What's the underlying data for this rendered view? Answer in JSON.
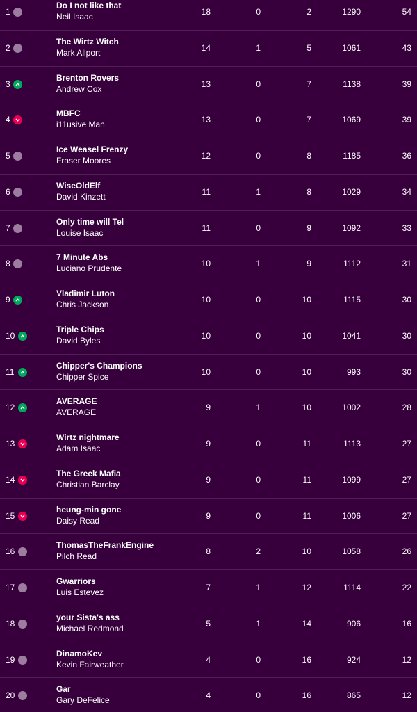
{
  "colors": {
    "background": "#37003c",
    "same": "#9c7c9f",
    "up": "#01a75d",
    "down": "#e90052"
  },
  "rows": [
    {
      "rank": "1",
      "move": "same",
      "team": "Do I not like that",
      "manager": "Neil Isaac",
      "w": "18",
      "d": "0",
      "l": "2",
      "pf": "1290",
      "pts": "54"
    },
    {
      "rank": "2",
      "move": "same",
      "team": "The Wirtz Witch",
      "manager": "Mark Allport",
      "w": "14",
      "d": "1",
      "l": "5",
      "pf": "1061",
      "pts": "43"
    },
    {
      "rank": "3",
      "move": "up",
      "team": "Brenton Rovers",
      "manager": "Andrew Cox",
      "w": "13",
      "d": "0",
      "l": "7",
      "pf": "1138",
      "pts": "39"
    },
    {
      "rank": "4",
      "move": "down",
      "team": "MBFC",
      "manager": "i11usive Man",
      "w": "13",
      "d": "0",
      "l": "7",
      "pf": "1069",
      "pts": "39"
    },
    {
      "rank": "5",
      "move": "same",
      "team": "Ice Weasel Frenzy",
      "manager": "Fraser Moores",
      "w": "12",
      "d": "0",
      "l": "8",
      "pf": "1185",
      "pts": "36"
    },
    {
      "rank": "6",
      "move": "same",
      "team": "WiseOldElf",
      "manager": "David Kinzett",
      "w": "11",
      "d": "1",
      "l": "8",
      "pf": "1029",
      "pts": "34"
    },
    {
      "rank": "7",
      "move": "same",
      "team": "Only time will Tel",
      "manager": "Louise Isaac",
      "w": "11",
      "d": "0",
      "l": "9",
      "pf": "1092",
      "pts": "33"
    },
    {
      "rank": "8",
      "move": "same",
      "team": "7 Minute Abs",
      "manager": "Luciano Prudente",
      "w": "10",
      "d": "1",
      "l": "9",
      "pf": "1112",
      "pts": "31"
    },
    {
      "rank": "9",
      "move": "up",
      "team": "Vladimir Luton",
      "manager": "Chris Jackson",
      "w": "10",
      "d": "0",
      "l": "10",
      "pf": "1115",
      "pts": "30"
    },
    {
      "rank": "10",
      "move": "up",
      "team": "Triple Chips",
      "manager": "David Byles",
      "w": "10",
      "d": "0",
      "l": "10",
      "pf": "1041",
      "pts": "30"
    },
    {
      "rank": "11",
      "move": "up",
      "team": "Chipper's Champions",
      "manager": "Chipper Spice",
      "w": "10",
      "d": "0",
      "l": "10",
      "pf": "993",
      "pts": "30"
    },
    {
      "rank": "12",
      "move": "up",
      "team": "AVERAGE",
      "manager": "AVERAGE",
      "w": "9",
      "d": "1",
      "l": "10",
      "pf": "1002",
      "pts": "28"
    },
    {
      "rank": "13",
      "move": "down",
      "team": "Wirtz nightmare",
      "manager": "Adam Isaac",
      "w": "9",
      "d": "0",
      "l": "11",
      "pf": "1113",
      "pts": "27"
    },
    {
      "rank": "14",
      "move": "down",
      "team": "The Greek Mafia",
      "manager": "Christian Barclay",
      "w": "9",
      "d": "0",
      "l": "11",
      "pf": "1099",
      "pts": "27"
    },
    {
      "rank": "15",
      "move": "down",
      "team": "heung-min gone",
      "manager": "Daisy Read",
      "w": "9",
      "d": "0",
      "l": "11",
      "pf": "1006",
      "pts": "27"
    },
    {
      "rank": "16",
      "move": "same",
      "team": "ThomasTheFrankEngine",
      "manager": "Pilch Read",
      "w": "8",
      "d": "2",
      "l": "10",
      "pf": "1058",
      "pts": "26"
    },
    {
      "rank": "17",
      "move": "same",
      "team": "Gwarriors",
      "manager": "Luis Estevez",
      "w": "7",
      "d": "1",
      "l": "12",
      "pf": "1114",
      "pts": "22"
    },
    {
      "rank": "18",
      "move": "same",
      "team": "your Sista's ass",
      "manager": "Michael Redmond",
      "w": "5",
      "d": "1",
      "l": "14",
      "pf": "906",
      "pts": "16"
    },
    {
      "rank": "19",
      "move": "same",
      "team": "DinamoKev",
      "manager": "Kevin Fairweather",
      "w": "4",
      "d": "0",
      "l": "16",
      "pf": "924",
      "pts": "12"
    },
    {
      "rank": "20",
      "move": "same",
      "team": "Gar",
      "manager": "Gary DeFelice",
      "w": "4",
      "d": "0",
      "l": "16",
      "pf": "865",
      "pts": "12"
    }
  ]
}
